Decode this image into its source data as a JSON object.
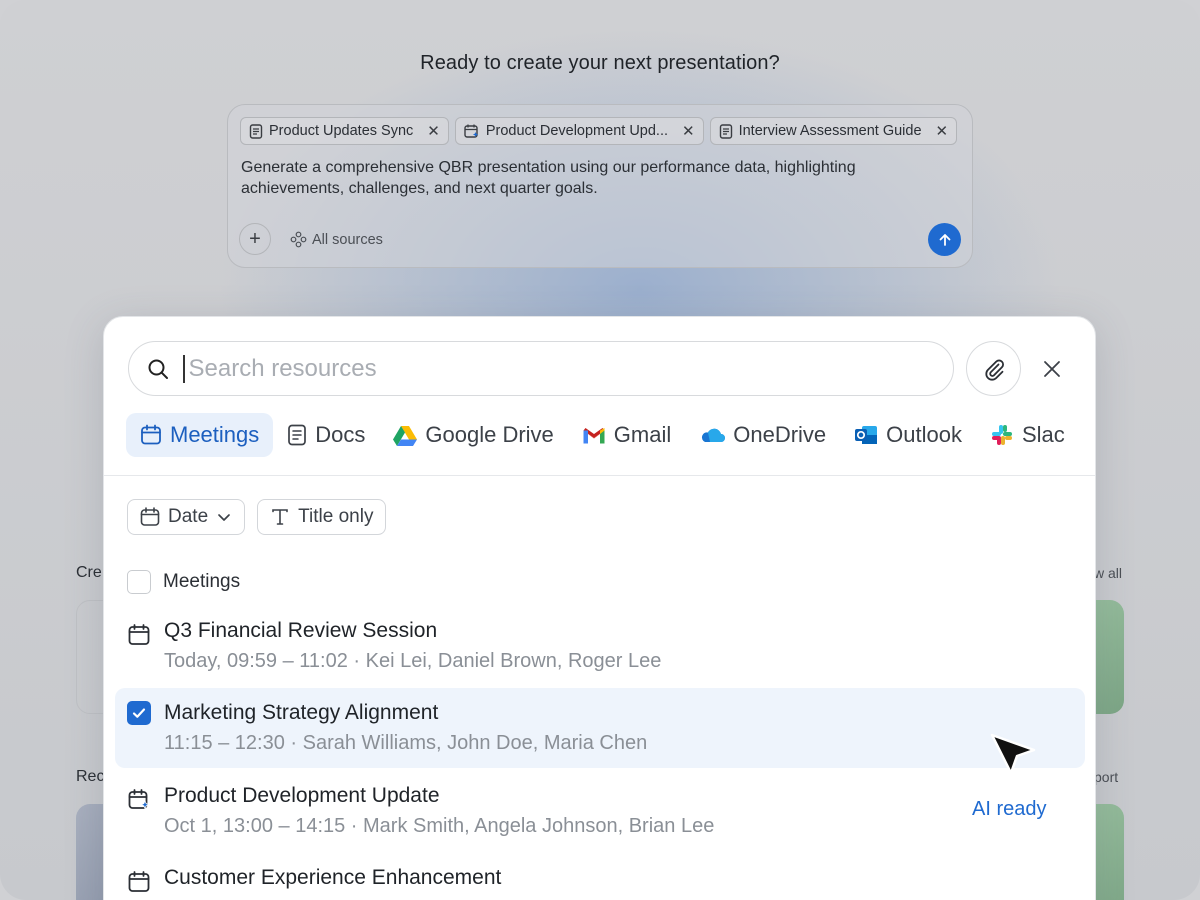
{
  "headline": "Ready to create your next presentation?",
  "composer": {
    "chips": [
      {
        "label": "Product Updates Sync",
        "icon": "doc-icon"
      },
      {
        "label": "Product Development Upd...",
        "icon": "calendar-ai-icon"
      },
      {
        "label": "Interview Assessment Guide",
        "icon": "doc-icon"
      }
    ],
    "prompt": "Generate a comprehensive QBR presentation using our performance data, highlighting achievements, challenges, and next quarter goals.",
    "sources_label": "All sources"
  },
  "background": {
    "label_left_1": "Cre",
    "label_right_1": "w all",
    "label_left_2": "Rec",
    "label_right_2": "port"
  },
  "panel": {
    "search_placeholder": "Search resources",
    "tabs": [
      {
        "label": "Meetings",
        "icon": "calendar-icon",
        "active": true
      },
      {
        "label": "Docs",
        "icon": "doc-icon"
      },
      {
        "label": "Google Drive",
        "icon": "google-drive-icon"
      },
      {
        "label": "Gmail",
        "icon": "gmail-icon"
      },
      {
        "label": "OneDrive",
        "icon": "onedrive-icon"
      },
      {
        "label": "Outlook",
        "icon": "outlook-icon"
      },
      {
        "label": "Slac",
        "icon": "slack-icon"
      }
    ],
    "filters": {
      "date": "Date",
      "title_only": "Title only"
    },
    "list_header": "Meetings",
    "items": [
      {
        "title": "Q3 Financial Review Session",
        "meta": "Today, 09:59 – 11:02 · Kei Lei, Daniel Brown, Roger Lee",
        "checked": false
      },
      {
        "title": "Marketing Strategy Alignment",
        "meta": "11:15 – 12:30 · Sarah Williams, John Doe, Maria Chen",
        "checked": true
      },
      {
        "title": "Product Development Update",
        "meta": "Oct 1, 13:00 – 14:15 · Mark Smith, Angela Johnson, Brian Lee",
        "checked": false,
        "ai": true
      },
      {
        "title": "Customer Experience Enhancement",
        "meta": "",
        "checked": false
      }
    ],
    "ai_ready_label": "AI ready"
  },
  "colors": {
    "accent": "#1f6ad0",
    "active_tab_bg": "#e8f0fb",
    "selected_row_bg": "#eef4fc"
  }
}
